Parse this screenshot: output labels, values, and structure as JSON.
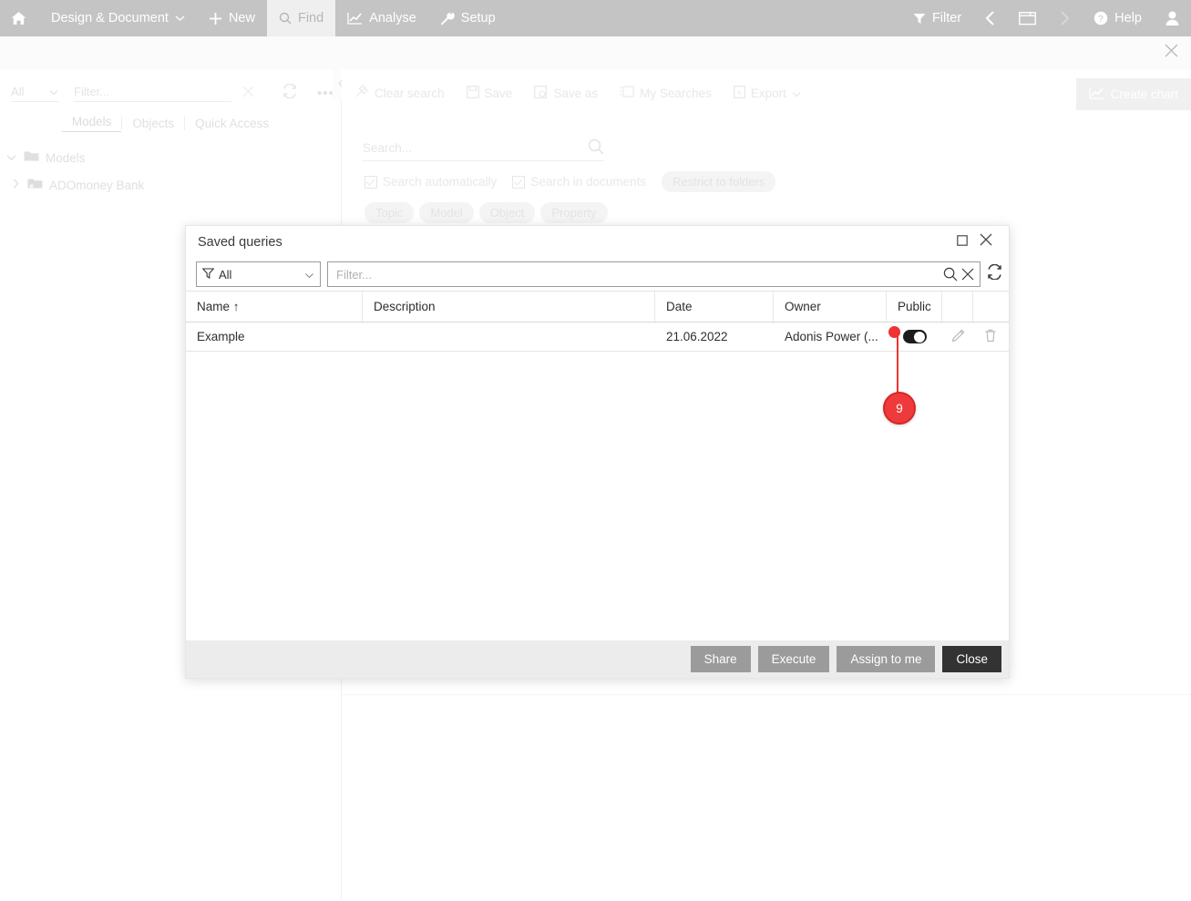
{
  "topbar": {
    "home_icon": "home-icon",
    "items": [
      {
        "label": "Design & Document",
        "icon": "chevron-down-icon"
      },
      {
        "label": "New",
        "icon": "plus-icon"
      },
      {
        "label": "Find",
        "icon": "search-icon"
      },
      {
        "label": "Analyse",
        "icon": "chart-line-icon"
      },
      {
        "label": "Setup",
        "icon": "wrench-icon"
      }
    ],
    "right": {
      "filter_label": "Filter",
      "filter_icon": "funnel-icon",
      "back_icon": "chevron-left-icon",
      "window_icon": "window-icon",
      "forward_icon": "chevron-right-icon",
      "help_label": "Help",
      "help_icon": "question-circle-icon",
      "user_icon": "user-icon"
    }
  },
  "subbar": {
    "close_icon": "close-icon"
  },
  "left_panel": {
    "filter": {
      "select_value": "All",
      "input_placeholder": "Filter...",
      "clear_icon": "close-icon",
      "refresh_icon": "refresh-icon",
      "more_icon": "more-icon",
      "more_label": "•••"
    },
    "tabs": [
      {
        "label": "Models",
        "selected": true
      },
      {
        "label": "Objects",
        "selected": false
      },
      {
        "label": "Quick Access",
        "selected": false
      }
    ],
    "tree": [
      {
        "label": "Models",
        "icon": "folder-open-icon",
        "expander": "chevron-down-icon",
        "level": 0
      },
      {
        "label": "ADOmoney Bank",
        "icon": "folder-locked-icon",
        "expander": "chevron-right-icon",
        "level": 1
      }
    ],
    "collapse_icon": "chevron-left-icon"
  },
  "main_panel": {
    "toolbar": [
      {
        "label": "Clear search",
        "icon": "clear-search-icon"
      },
      {
        "label": "Save",
        "icon": "save-icon"
      },
      {
        "label": "Save as",
        "icon": "save-as-icon"
      },
      {
        "label": "My Searches",
        "icon": "my-searches-icon"
      },
      {
        "label": "Export",
        "icon": "export-icon",
        "caret": "chevron-down-icon"
      }
    ],
    "search": {
      "placeholder": "Search...",
      "value": "",
      "icon": "search-icon"
    },
    "options": [
      {
        "label": "Search automatically",
        "checked": true
      },
      {
        "label": "Search in documents",
        "checked": true
      }
    ],
    "restrict_label": "Restrict to folders",
    "pills": [
      "Topic",
      "Model",
      "Object",
      "Property"
    ],
    "create_chart": {
      "label": "Create chart",
      "icon": "chart-line-icon"
    }
  },
  "dialog": {
    "title": "Saved queries",
    "maximize_icon": "maximize-icon",
    "close_icon": "close-icon",
    "filter": {
      "type_value": "All",
      "type_icon": "funnel-icon",
      "type_caret": "chevron-down-icon",
      "input_placeholder": "Filter...",
      "input_value": "",
      "search_icon": "search-icon",
      "clear_icon": "close-icon",
      "refresh_icon": "refresh-icon"
    },
    "table": {
      "columns": [
        {
          "label": "Name ↑"
        },
        {
          "label": "Description"
        },
        {
          "label": "Date"
        },
        {
          "label": "Owner"
        },
        {
          "label": "Public"
        },
        {
          "label": ""
        },
        {
          "label": ""
        }
      ],
      "rows": [
        {
          "name": "Example",
          "description": "",
          "date": "21.06.2022",
          "owner": "Adonis Power (...",
          "public": true,
          "edit_icon": "pencil-icon",
          "delete_icon": "trash-icon"
        }
      ]
    },
    "buttons": [
      {
        "label": "Share",
        "style": "normal"
      },
      {
        "label": "Execute",
        "style": "normal"
      },
      {
        "label": "Assign to me",
        "style": "normal"
      },
      {
        "label": "Close",
        "style": "dark"
      }
    ]
  },
  "annotation": {
    "badge_number": "9",
    "color": "#ee3a3a"
  }
}
